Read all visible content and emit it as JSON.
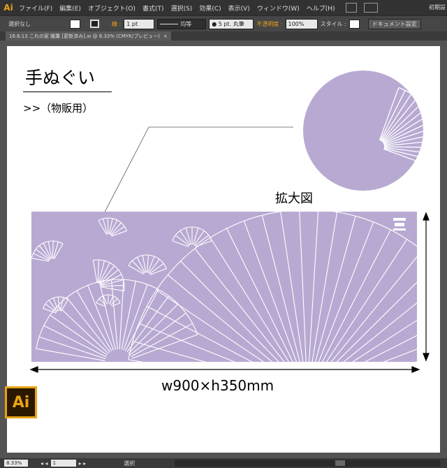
{
  "app": {
    "logo": "Ai",
    "badge_label": "Ai"
  },
  "menu": {
    "items": [
      "ファイル(F)",
      "編集(E)",
      "オブジェクト(O)",
      "書式(T)",
      "選択(S)",
      "効果(C)",
      "表示(V)",
      "ウィンドウ(W)",
      "ヘルプ(H)"
    ],
    "right_text": "初期設"
  },
  "control": {
    "selection": "選択なし",
    "stroke_label": "線 :",
    "stroke_weight": "1 pt",
    "stroke_profile": "均等",
    "brush": "● 5 pt. 丸筆",
    "opacity_label": "不透明度 :",
    "opacity_value": "100%",
    "style_label": "スタイル :",
    "doc_settings": "ドキュメント設定"
  },
  "document": {
    "tab_title": "16.6.13 これの家 暖簾 [更新済み].ai @ 8.33% (CMYK/プレビュー)",
    "close": "×"
  },
  "artboard": {
    "title": "手ぬぐい",
    "subtitle": ">>（物販用）",
    "zoom_label": "拡大図",
    "dimensions": "w900×h350mm",
    "brand_mark": "大中図鑑",
    "design_color": "#b8a9d2"
  },
  "status": {
    "zoom": "8.33%",
    "page": "1",
    "tool": "選択"
  },
  "icons": [
    "arrange-icon",
    "workspace-icon",
    "stroke-color-icon",
    "fill-color-icon",
    "close-icon"
  ]
}
